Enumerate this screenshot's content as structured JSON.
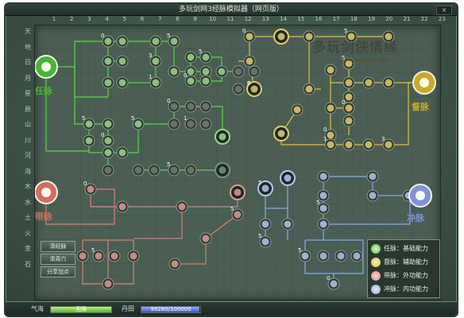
{
  "window": {
    "title": "多玩剑网3经脉模拟器（网页版）",
    "close_label": "×"
  },
  "grid": {
    "columns": [
      "1",
      "2",
      "3",
      "4",
      "5",
      "6",
      "7",
      "8",
      "9",
      "10",
      "11",
      "12",
      "13",
      "14",
      "15",
      "16",
      "17",
      "18",
      "19",
      "20",
      "21",
      "22",
      "23"
    ],
    "rows": [
      "天",
      "地",
      "日",
      "月",
      "星",
      "辰",
      "山",
      "川",
      "河",
      "海",
      "木",
      "水",
      "土",
      "火",
      "金",
      "石"
    ]
  },
  "meridians": {
    "ren": {
      "name": "任脉",
      "color": "#59d642"
    },
    "du": {
      "name": "督脉",
      "color": "#e0c23a"
    },
    "dai": {
      "name": "带脉",
      "color": "#d98173"
    },
    "chong": {
      "name": "冲脉",
      "color": "#8ea7e6"
    }
  },
  "side_buttons": [
    {
      "label": "清经脉"
    },
    {
      "label": "清奇穴"
    },
    {
      "label": "分享加点"
    }
  ],
  "legend": {
    "items": [
      {
        "label": "任脉：基础能力",
        "color": "#4fc23c",
        "icon": "ren-seal-icon"
      },
      {
        "label": "督脉：辅助能力",
        "color": "#d8b936",
        "icon": "du-seal-icon"
      },
      {
        "label": "带脉：外功能力",
        "color": "#cf7d70",
        "icon": "dai-seal-icon"
      },
      {
        "label": "冲脉：内功能力",
        "color": "#8aa2e0",
        "icon": "chong-seal-icon"
      }
    ]
  },
  "status": {
    "qihai_label": "气海",
    "qihai_value": "无限",
    "qihai_fill": 1.0,
    "dantian_label": "丹田",
    "dantian_value": "99280/100000",
    "dantian_fill": 0.9928
  },
  "watermark": {
    "text": "多玩剑侠情缘",
    "url": "jx3.duowan.com"
  },
  "node_counts": {
    "labels": [
      "0",
      "5",
      "3",
      "1",
      "5",
      "0",
      "5",
      "0",
      "5",
      "0",
      "1",
      "0",
      "5",
      "0",
      "5",
      "5",
      "5",
      "0",
      "0",
      "1",
      "3",
      "0",
      "5",
      "5",
      "5",
      "5",
      "5",
      "5",
      "0",
      "0",
      "0",
      "0",
      "5",
      "0",
      "5",
      "3",
      "3",
      "5"
    ]
  }
}
